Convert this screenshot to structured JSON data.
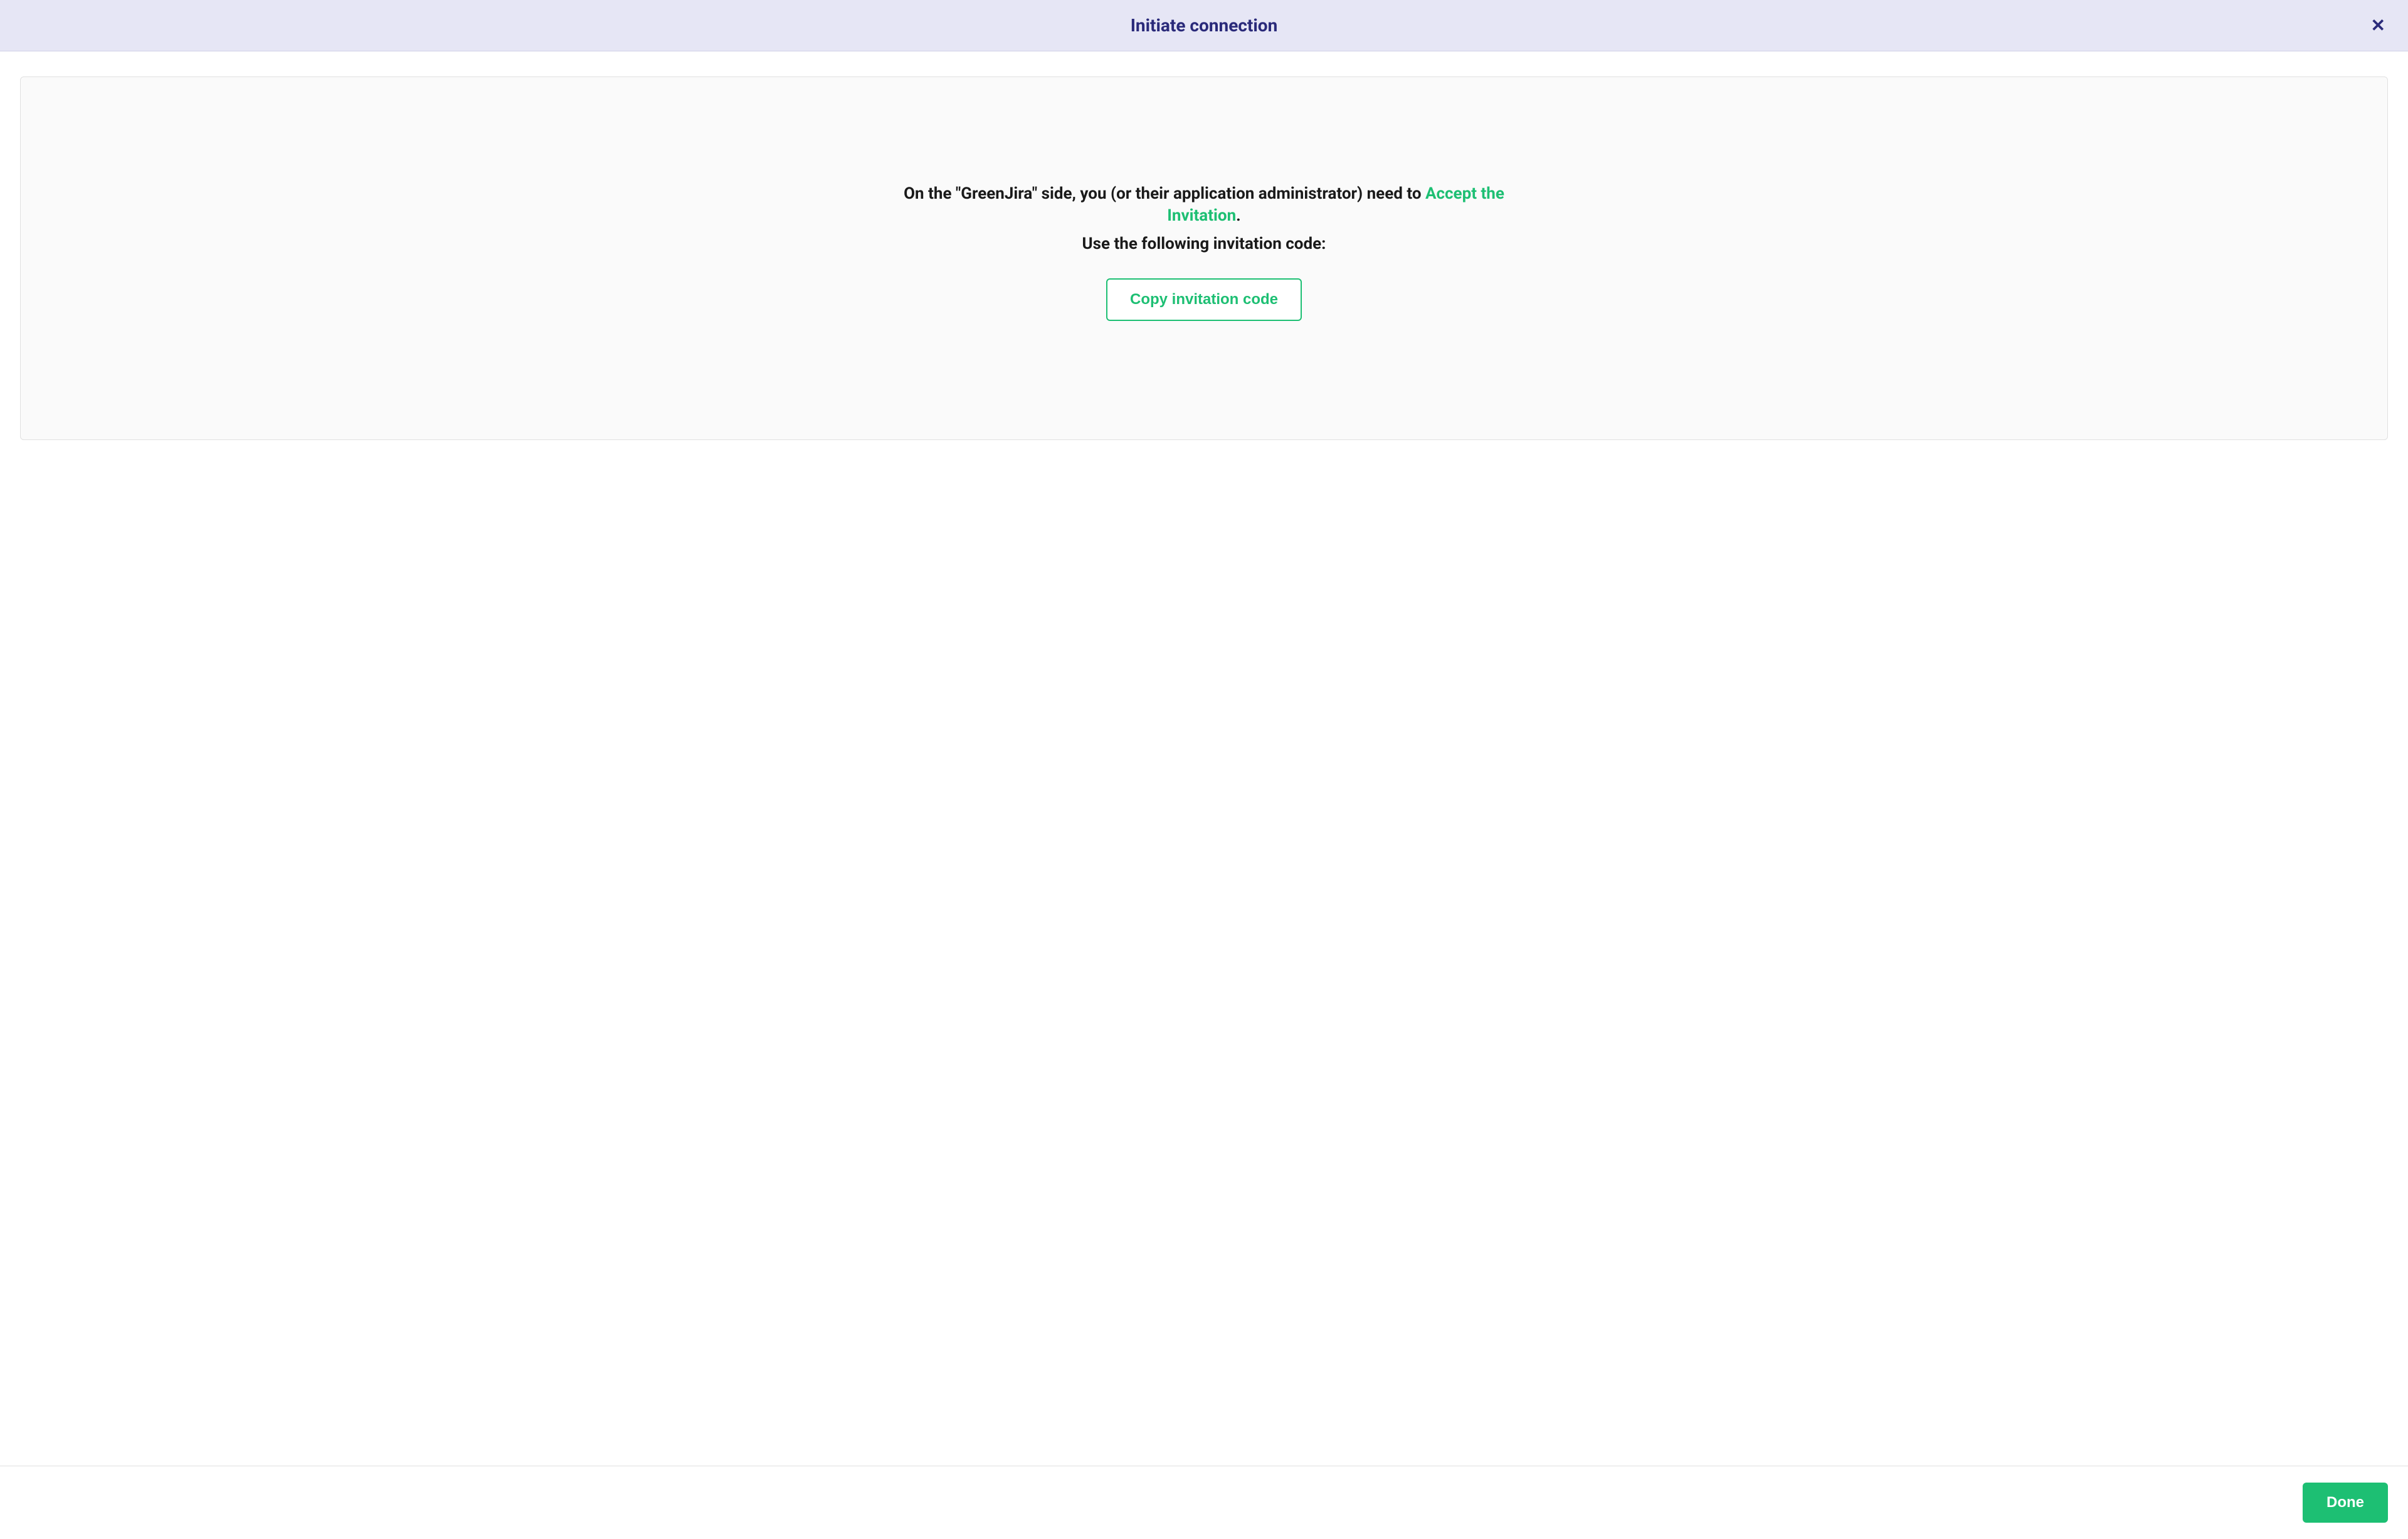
{
  "header": {
    "title": "Initiate connection",
    "close_icon": "✕"
  },
  "content": {
    "instruction_prefix": "On the \"GreenJira\" side, you (or their application administrator) need to ",
    "instruction_link": "Accept the Invitation",
    "instruction_suffix": ".",
    "sub_instruction": "Use the following invitation code:",
    "copy_button_label": "Copy invitation code"
  },
  "footer": {
    "done_label": "Done"
  },
  "colors": {
    "header_bg": "#e6e6f5",
    "title_color": "#2a2a7a",
    "accent_green": "#1dbf73",
    "panel_bg": "#fafafa",
    "border": "#e0e0e0"
  }
}
